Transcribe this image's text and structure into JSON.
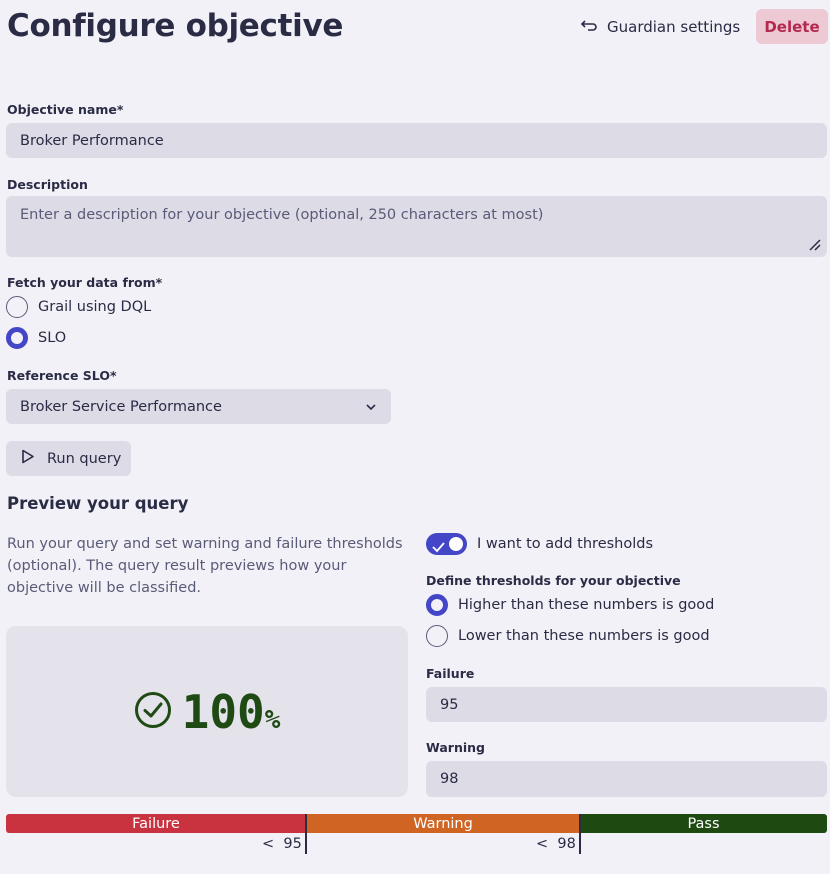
{
  "header": {
    "title": "Configure objective",
    "guardian_settings_label": "Guardian settings",
    "delete_label": "Delete"
  },
  "form": {
    "objective_name_label": "Objective name*",
    "objective_name_value": "Broker Performance",
    "description_label": "Description",
    "description_placeholder": "Enter a description for your objective (optional, 250 characters at most)",
    "fetch_label": "Fetch your data from*",
    "fetch_options": [
      {
        "label": "Grail using DQL",
        "selected": false
      },
      {
        "label": "SLO",
        "selected": true
      }
    ],
    "reference_slo_label": "Reference SLO*",
    "reference_slo_value": "Broker Service Performance",
    "run_query_label": "Run query"
  },
  "preview": {
    "title": "Preview your query",
    "description": "Run your query and set warning and failure thresholds (optional). The query result previews how your objective will be classified.",
    "value": "100",
    "unit": "%",
    "status_icon": "check-circle-icon"
  },
  "thresholds": {
    "toggle_label": "I want to add thresholds",
    "toggle_on": true,
    "define_label": "Define thresholds for your objective",
    "direction_options": [
      {
        "label": "Higher than these numbers is good",
        "selected": true
      },
      {
        "label": "Lower than these numbers is good",
        "selected": false
      }
    ],
    "failure_label": "Failure",
    "failure_value": "95",
    "warning_label": "Warning",
    "warning_value": "98"
  },
  "scale": {
    "segments": [
      {
        "label": "Failure",
        "color": "#c9323f"
      },
      {
        "label": "Warning",
        "color": "#d06523"
      },
      {
        "label": "Pass",
        "color": "#1e4a12"
      }
    ],
    "ticks": [
      "<  95",
      "<  98"
    ]
  },
  "colors": {
    "accent": "#4346c7",
    "delete": "#b42a4e",
    "pass_text": "#1f4a14"
  }
}
